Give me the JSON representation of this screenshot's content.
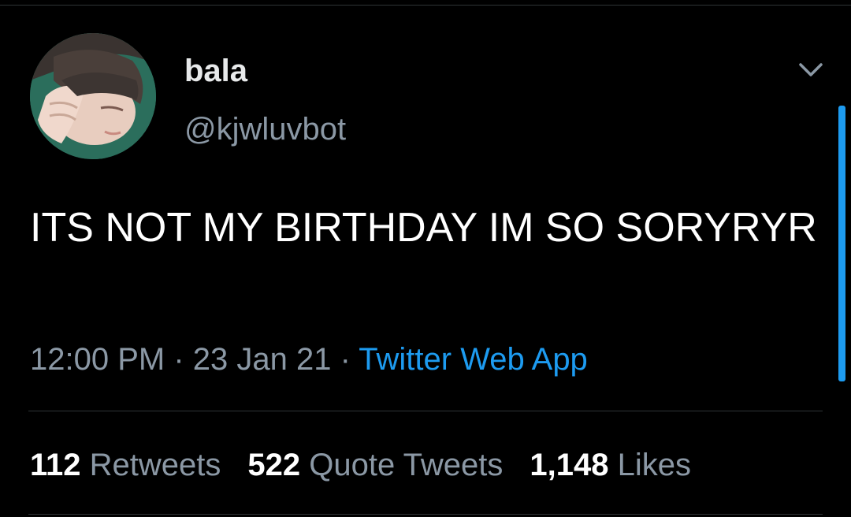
{
  "author": {
    "display_name": "bala",
    "handle": "@kjwluvbot"
  },
  "tweet": {
    "text": "ITS NOT MY BIRTHDAY IM SO SORYRYR"
  },
  "meta": {
    "time": "12:00 PM",
    "date": "23 Jan 21",
    "separator": " · ",
    "source": "Twitter Web App"
  },
  "stats": {
    "retweets": {
      "count": "112",
      "label": "Retweets"
    },
    "quotes": {
      "count": "522",
      "label": "Quote Tweets"
    },
    "likes": {
      "count": "1,148",
      "label": "Likes"
    }
  },
  "icons": {
    "more": "chevron-down-icon"
  },
  "colors": {
    "background": "#000000",
    "text": "#ffffff",
    "secondary": "#8b98a5",
    "accent": "#1d9bf0",
    "divider": "#2f3336"
  }
}
